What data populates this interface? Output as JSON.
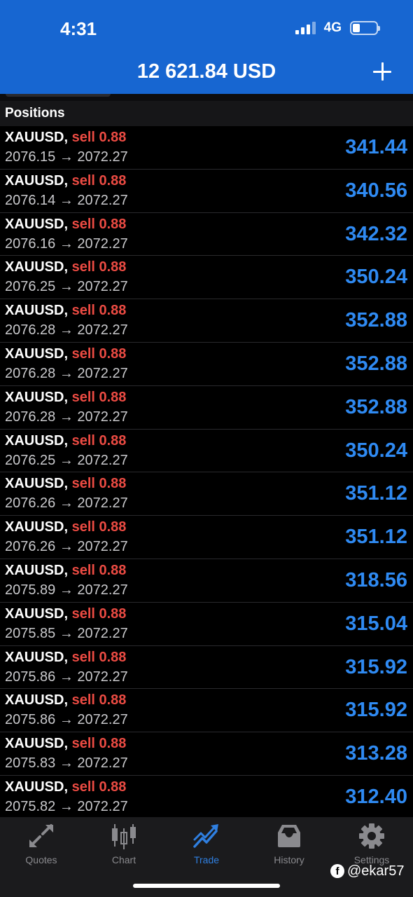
{
  "status_bar": {
    "time": "4:31",
    "network": "4G"
  },
  "header": {
    "balance": "12 621.84 USD"
  },
  "section": {
    "title": "Positions"
  },
  "positions": [
    {
      "symbol": "XAUUSD,",
      "side": "sell 0.88",
      "prices": "2076.15 → 2072.27",
      "profit": "341.44"
    },
    {
      "symbol": "XAUUSD,",
      "side": "sell 0.88",
      "prices": "2076.14 → 2072.27",
      "profit": "340.56"
    },
    {
      "symbol": "XAUUSD,",
      "side": "sell 0.88",
      "prices": "2076.16 → 2072.27",
      "profit": "342.32"
    },
    {
      "symbol": "XAUUSD,",
      "side": "sell 0.88",
      "prices": "2076.25 → 2072.27",
      "profit": "350.24"
    },
    {
      "symbol": "XAUUSD,",
      "side": "sell 0.88",
      "prices": "2076.28 → 2072.27",
      "profit": "352.88"
    },
    {
      "symbol": "XAUUSD,",
      "side": "sell 0.88",
      "prices": "2076.28 → 2072.27",
      "profit": "352.88"
    },
    {
      "symbol": "XAUUSD,",
      "side": "sell 0.88",
      "prices": "2076.28 → 2072.27",
      "profit": "352.88"
    },
    {
      "symbol": "XAUUSD,",
      "side": "sell 0.88",
      "prices": "2076.25 → 2072.27",
      "profit": "350.24"
    },
    {
      "symbol": "XAUUSD,",
      "side": "sell 0.88",
      "prices": "2076.26 → 2072.27",
      "profit": "351.12"
    },
    {
      "symbol": "XAUUSD,",
      "side": "sell 0.88",
      "prices": "2076.26 → 2072.27",
      "profit": "351.12"
    },
    {
      "symbol": "XAUUSD,",
      "side": "sell 0.88",
      "prices": "2075.89 → 2072.27",
      "profit": "318.56"
    },
    {
      "symbol": "XAUUSD,",
      "side": "sell 0.88",
      "prices": "2075.85 → 2072.27",
      "profit": "315.04"
    },
    {
      "symbol": "XAUUSD,",
      "side": "sell 0.88",
      "prices": "2075.86 → 2072.27",
      "profit": "315.92"
    },
    {
      "symbol": "XAUUSD,",
      "side": "sell 0.88",
      "prices": "2075.86 → 2072.27",
      "profit": "315.92"
    },
    {
      "symbol": "XAUUSD,",
      "side": "sell 0.88",
      "prices": "2075.83 → 2072.27",
      "profit": "313.28"
    },
    {
      "symbol": "XAUUSD,",
      "side": "sell 0.88",
      "prices": "2075.82 → 2072.27",
      "profit": "312.40"
    }
  ],
  "tabs": [
    {
      "label": "Quotes",
      "icon": "quotes-arrows-icon",
      "active": false
    },
    {
      "label": "Chart",
      "icon": "candlestick-chart-icon",
      "active": false
    },
    {
      "label": "Trade",
      "icon": "trade-trend-icon",
      "active": true
    },
    {
      "label": "History",
      "icon": "history-tray-icon",
      "active": false
    },
    {
      "label": "Settings",
      "icon": "gear-icon",
      "active": false
    }
  ],
  "watermark": {
    "text": "@ekar57"
  },
  "colors": {
    "header_bg": "#1766d1",
    "sell": "#ec4b43",
    "profit": "#2f8af2",
    "tab_active": "#2f7fe0",
    "tab_inactive": "#8a8a8e"
  }
}
